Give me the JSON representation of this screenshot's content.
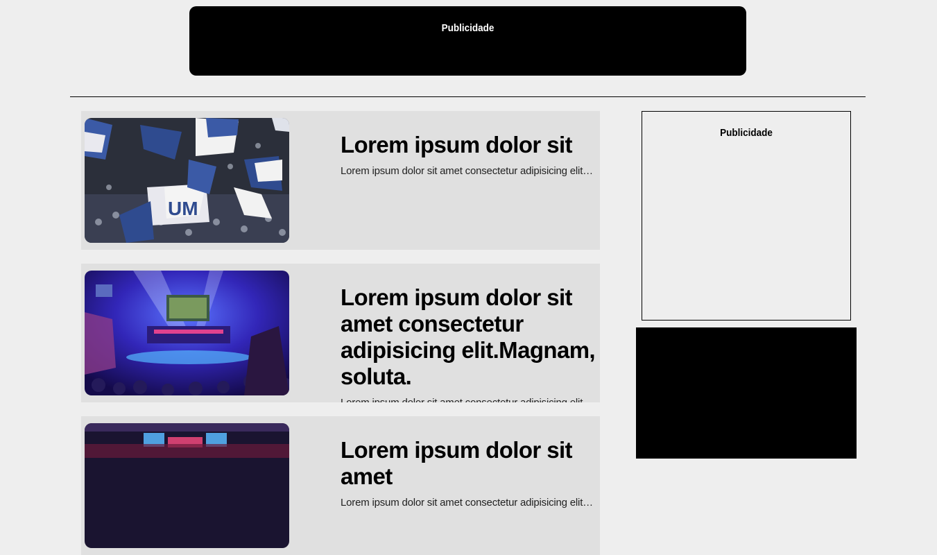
{
  "ads": {
    "top_label": "Publicidade",
    "sidebar_label": "Publicidade"
  },
  "articles": [
    {
      "title": "Lorem ipsum dolor sit",
      "excerpt": "Lorem ipsum dolor sit amet consectetur adipisicing elit. Magnam, soluta.",
      "image": "crowd-flags-photo"
    },
    {
      "title": "Lorem ipsum dolor sit amet consectetur adipisicing elit.Magnam, soluta.",
      "excerpt": "Lorem ipsum dolor sit amet consectetur adipisicing elit. Magnam, soluta.",
      "image": "esports-arena-photo"
    },
    {
      "title": "Lorem ipsum dolor sit amet",
      "excerpt": "Lorem ipsum dolor sit amet consectetur adipisicing elit. Magnam, soluta.",
      "image": "esports-stage-photo"
    }
  ]
}
